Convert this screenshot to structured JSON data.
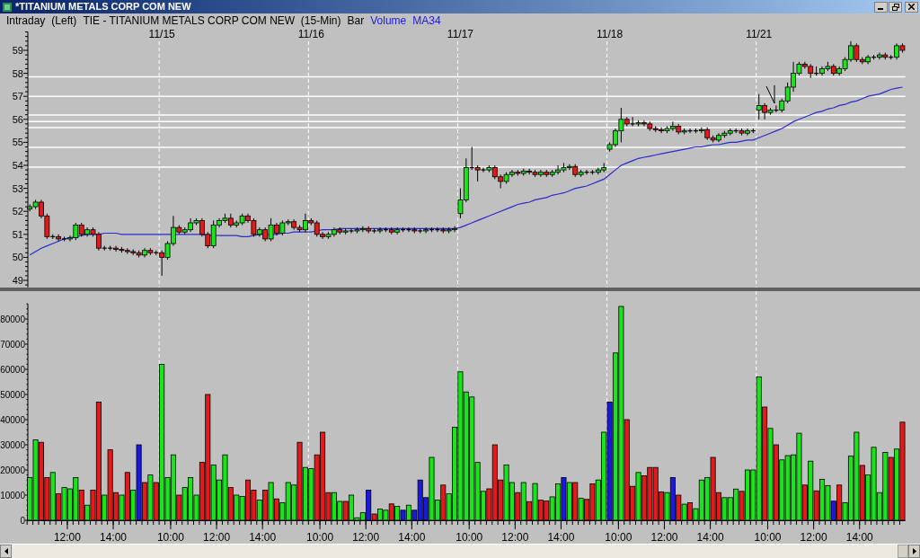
{
  "window": {
    "title": "*TITANIUM METALS CORP COM NEW"
  },
  "header": [
    {
      "text": "Intraday"
    },
    {
      "text": "(Left)"
    },
    {
      "text": "TIE - TITANIUM METALS CORP COM NEW  (15-Min)"
    },
    {
      "text": "Bar"
    }
  ],
  "price_panel": {
    "chart_data": {
      "type": "candlestick",
      "ylim": [
        48.7,
        59.8
      ],
      "yticks": [
        49,
        50,
        51,
        52,
        53,
        54,
        55,
        56,
        57,
        58,
        59
      ],
      "categories": [
        null,
        null,
        null,
        null,
        null,
        null,
        null,
        null,
        null,
        null,
        null,
        null,
        null,
        null,
        null,
        null,
        null,
        null,
        null,
        null,
        null,
        null,
        null,
        "11/15",
        null,
        null,
        null,
        null,
        null,
        null,
        null,
        null,
        null,
        null,
        null,
        null,
        null,
        null,
        null,
        null,
        null,
        null,
        null,
        null,
        null,
        null,
        null,
        null,
        null,
        "11/16",
        null,
        null,
        null,
        null,
        null,
        null,
        null,
        null,
        null,
        null,
        null,
        null,
        null,
        null,
        null,
        null,
        null,
        null,
        null,
        null,
        null,
        null,
        null,
        null,
        null,
        "11/17",
        null,
        null,
        null,
        null,
        null,
        null,
        null,
        null,
        null,
        null,
        null,
        null,
        null,
        null,
        null,
        null,
        null,
        null,
        null,
        null,
        null,
        null,
        null,
        null,
        null,
        "11/18",
        null,
        null,
        null,
        null,
        null,
        null,
        null,
        null,
        null,
        null,
        null,
        null,
        null,
        null,
        null,
        null,
        null,
        null,
        null,
        null,
        null,
        null,
        null,
        null,
        null,
        "11/21",
        null,
        null,
        null,
        null,
        null,
        null,
        null,
        null,
        null,
        null,
        null,
        null,
        null,
        null,
        null,
        null,
        null,
        null,
        null,
        null,
        null,
        null,
        null,
        null,
        null
      ],
      "ohlc": [
        [
          52.1,
          52.3,
          52.0,
          52.2
        ],
        [
          52.2,
          52.5,
          52.1,
          52.4
        ],
        [
          52.4,
          52.5,
          51.7,
          51.8
        ],
        [
          51.8,
          51.9,
          50.8,
          50.9
        ],
        [
          50.9,
          51.0,
          50.8,
          50.9
        ],
        [
          50.9,
          51.0,
          50.7,
          50.8
        ],
        [
          50.8,
          50.9,
          50.7,
          50.8
        ],
        [
          50.8,
          50.95,
          50.7,
          50.85
        ],
        [
          50.85,
          51.5,
          50.75,
          51.4
        ],
        [
          51.4,
          51.5,
          50.9,
          51.0
        ],
        [
          51.0,
          51.3,
          50.9,
          51.2
        ],
        [
          51.2,
          51.3,
          50.9,
          51.0
        ],
        [
          51.0,
          51.1,
          50.3,
          50.4
        ],
        [
          50.4,
          50.5,
          50.3,
          50.4
        ],
        [
          50.4,
          50.5,
          50.3,
          50.4
        ],
        [
          50.4,
          50.5,
          50.25,
          50.35
        ],
        [
          50.35,
          50.45,
          50.2,
          50.3
        ],
        [
          50.3,
          50.4,
          50.15,
          50.25
        ],
        [
          50.25,
          50.35,
          50.1,
          50.2
        ],
        [
          50.2,
          50.3,
          50.0,
          50.1
        ],
        [
          50.1,
          50.4,
          50.0,
          50.3
        ],
        [
          50.3,
          50.4,
          50.1,
          50.2
        ],
        [
          50.2,
          50.3,
          50.1,
          50.2
        ],
        [
          50.2,
          50.3,
          49.2,
          50.0
        ],
        [
          50.0,
          50.7,
          49.9,
          50.6
        ],
        [
          50.6,
          51.8,
          50.5,
          51.3
        ],
        [
          51.3,
          51.4,
          51.0,
          51.1
        ],
        [
          51.1,
          51.3,
          51.0,
          51.2
        ],
        [
          51.2,
          51.7,
          51.1,
          51.5
        ],
        [
          51.5,
          51.7,
          51.4,
          51.6
        ],
        [
          51.6,
          51.7,
          50.9,
          51.0
        ],
        [
          51.0,
          51.1,
          50.4,
          50.5
        ],
        [
          50.5,
          51.6,
          50.4,
          51.4
        ],
        [
          51.4,
          51.7,
          51.3,
          51.6
        ],
        [
          51.6,
          51.9,
          51.5,
          51.7
        ],
        [
          51.7,
          51.9,
          51.3,
          51.4
        ],
        [
          51.4,
          51.6,
          51.3,
          51.5
        ],
        [
          51.5,
          51.9,
          51.4,
          51.8
        ],
        [
          51.8,
          51.9,
          51.5,
          51.6
        ],
        [
          51.6,
          51.7,
          50.9,
          51.0
        ],
        [
          51.0,
          51.3,
          50.9,
          51.2
        ],
        [
          51.2,
          51.3,
          50.7,
          50.8
        ],
        [
          50.8,
          51.7,
          50.7,
          51.4
        ],
        [
          51.4,
          51.5,
          50.95,
          51.05
        ],
        [
          51.05,
          51.6,
          50.95,
          51.5
        ],
        [
          51.5,
          51.65,
          51.4,
          51.55
        ],
        [
          51.55,
          51.65,
          51.2,
          51.3
        ],
        [
          51.3,
          51.4,
          51.1,
          51.2
        ],
        [
          51.2,
          51.9,
          51.1,
          51.6
        ],
        [
          51.6,
          51.7,
          51.4,
          51.5
        ],
        [
          51.5,
          51.6,
          50.9,
          51.0
        ],
        [
          51.0,
          51.1,
          50.8,
          50.9
        ],
        [
          50.9,
          51.1,
          50.8,
          51.0
        ],
        [
          51.0,
          51.3,
          50.9,
          51.2
        ],
        [
          51.2,
          51.3,
          51.0,
          51.1
        ],
        [
          51.1,
          51.25,
          51.0,
          51.15
        ],
        [
          51.15,
          51.25,
          51.05,
          51.15
        ],
        [
          51.15,
          51.3,
          51.05,
          51.2
        ],
        [
          51.2,
          51.35,
          51.1,
          51.25
        ],
        [
          51.25,
          51.35,
          51.05,
          51.15
        ],
        [
          51.15,
          51.25,
          51.05,
          51.15
        ],
        [
          51.15,
          51.3,
          51.05,
          51.2
        ],
        [
          51.2,
          51.3,
          51.1,
          51.2
        ],
        [
          51.2,
          51.3,
          51.0,
          51.1
        ],
        [
          51.1,
          51.3,
          51.0,
          51.2
        ],
        [
          51.2,
          51.3,
          51.1,
          51.2
        ],
        [
          51.2,
          51.3,
          51.1,
          51.2
        ],
        [
          51.2,
          51.3,
          51.05,
          51.15
        ],
        [
          51.15,
          51.25,
          51.05,
          51.15
        ],
        [
          51.15,
          51.3,
          51.05,
          51.2
        ],
        [
          51.2,
          51.3,
          51.1,
          51.2
        ],
        [
          51.2,
          51.3,
          51.1,
          51.2
        ],
        [
          51.2,
          51.3,
          51.05,
          51.15
        ],
        [
          51.15,
          51.3,
          51.05,
          51.2
        ],
        [
          51.2,
          51.35,
          51.1,
          51.25
        ],
        [
          51.9,
          53.0,
          51.7,
          52.5
        ],
        [
          52.5,
          54.3,
          52.4,
          53.9
        ],
        [
          53.9,
          54.8,
          53.8,
          53.9
        ],
        [
          53.9,
          54.0,
          53.3,
          53.8
        ],
        [
          53.8,
          53.9,
          53.7,
          53.8
        ],
        [
          53.8,
          54.0,
          53.7,
          53.9
        ],
        [
          53.9,
          54.0,
          53.4,
          53.5
        ],
        [
          53.5,
          53.6,
          53.0,
          53.3
        ],
        [
          53.3,
          53.7,
          53.2,
          53.6
        ],
        [
          53.6,
          53.8,
          53.5,
          53.7
        ],
        [
          53.7,
          53.8,
          53.55,
          53.65
        ],
        [
          53.65,
          53.85,
          53.55,
          53.75
        ],
        [
          53.75,
          53.85,
          53.6,
          53.7
        ],
        [
          53.7,
          53.8,
          53.5,
          53.6
        ],
        [
          53.6,
          53.8,
          53.5,
          53.7
        ],
        [
          53.7,
          53.8,
          53.5,
          53.6
        ],
        [
          53.6,
          53.8,
          53.5,
          53.7
        ],
        [
          53.7,
          54.0,
          53.6,
          53.8
        ],
        [
          53.8,
          54.1,
          53.7,
          53.9
        ],
        [
          53.9,
          54.05,
          53.8,
          53.95
        ],
        [
          53.95,
          54.05,
          53.5,
          53.6
        ],
        [
          53.6,
          53.8,
          53.5,
          53.7
        ],
        [
          53.7,
          53.8,
          53.6,
          53.7
        ],
        [
          53.7,
          53.8,
          53.6,
          53.7
        ],
        [
          53.7,
          53.9,
          53.6,
          53.8
        ],
        [
          53.8,
          54.1,
          53.7,
          53.9
        ],
        [
          54.7,
          55.0,
          54.6,
          54.9
        ],
        [
          54.9,
          55.6,
          54.8,
          55.5
        ],
        [
          55.5,
          56.5,
          55.0,
          56.0
        ],
        [
          56.0,
          56.1,
          55.7,
          55.8
        ],
        [
          55.8,
          56.1,
          55.7,
          55.8
        ],
        [
          55.8,
          55.95,
          55.7,
          55.85
        ],
        [
          55.85,
          55.95,
          55.7,
          55.8
        ],
        [
          55.8,
          55.9,
          55.5,
          55.6
        ],
        [
          55.6,
          55.7,
          55.45,
          55.55
        ],
        [
          55.55,
          55.65,
          55.4,
          55.5
        ],
        [
          55.5,
          55.7,
          55.4,
          55.6
        ],
        [
          55.6,
          55.9,
          55.5,
          55.7
        ],
        [
          55.7,
          55.8,
          55.35,
          55.45
        ],
        [
          55.45,
          55.6,
          55.35,
          55.5
        ],
        [
          55.5,
          55.6,
          55.4,
          55.5
        ],
        [
          55.5,
          55.6,
          55.4,
          55.5
        ],
        [
          55.5,
          55.65,
          55.4,
          55.55
        ],
        [
          55.55,
          55.65,
          55.1,
          55.2
        ],
        [
          55.2,
          55.3,
          55.0,
          55.1
        ],
        [
          55.1,
          55.4,
          55.0,
          55.3
        ],
        [
          55.3,
          55.5,
          55.2,
          55.4
        ],
        [
          55.4,
          55.6,
          55.3,
          55.5
        ],
        [
          55.5,
          55.6,
          55.4,
          55.5
        ],
        [
          55.5,
          55.6,
          55.3,
          55.4
        ],
        [
          55.4,
          55.6,
          55.3,
          55.5
        ],
        [
          55.5,
          55.6,
          55.4,
          55.5
        ],
        [
          56.4,
          57.1,
          56.0,
          56.6
        ],
        [
          56.6,
          56.7,
          56.0,
          56.3
        ],
        [
          56.3,
          56.5,
          56.2,
          56.4
        ],
        [
          56.4,
          56.6,
          56.3,
          56.4
        ],
        [
          56.4,
          56.9,
          56.3,
          56.8
        ],
        [
          56.8,
          57.6,
          56.7,
          57.4
        ],
        [
          57.4,
          58.5,
          57.2,
          58.0
        ],
        [
          58.0,
          58.5,
          57.9,
          58.4
        ],
        [
          58.4,
          58.5,
          58.2,
          58.3
        ],
        [
          58.3,
          58.4,
          57.8,
          58.0
        ],
        [
          58.0,
          58.3,
          57.9,
          58.0
        ],
        [
          58.0,
          58.3,
          57.9,
          58.2
        ],
        [
          58.2,
          58.5,
          58.1,
          58.3
        ],
        [
          58.3,
          58.4,
          57.9,
          58.0
        ],
        [
          58.0,
          58.3,
          57.9,
          58.2
        ],
        [
          58.2,
          58.7,
          58.1,
          58.6
        ],
        [
          58.6,
          59.4,
          58.5,
          59.2
        ],
        [
          59.2,
          59.3,
          58.5,
          58.6
        ],
        [
          58.6,
          58.7,
          58.4,
          58.5
        ],
        [
          58.5,
          58.8,
          58.4,
          58.7
        ],
        [
          58.7,
          58.8,
          58.6,
          58.7
        ],
        [
          58.7,
          58.9,
          58.6,
          58.8
        ],
        [
          58.8,
          58.9,
          58.6,
          58.7
        ],
        [
          58.7,
          58.8,
          58.6,
          58.7
        ],
        [
          58.7,
          59.3,
          58.6,
          59.2
        ],
        [
          59.2,
          59.3,
          58.9,
          59.0
        ]
      ],
      "series": [
        {
          "name": "MA34",
          "type": "line",
          "color": "#2a2ad0",
          "values": [
            50.1,
            50.25,
            50.4,
            50.5,
            50.6,
            50.7,
            50.8,
            50.85,
            50.9,
            50.95,
            51.0,
            51.0,
            51.0,
            51.05,
            51.05,
            51.05,
            51.0,
            51.0,
            51.0,
            51.0,
            51.0,
            51.0,
            51.0,
            51.0,
            51.0,
            51.0,
            51.0,
            51.0,
            51.0,
            51.0,
            51.0,
            50.95,
            50.95,
            50.95,
            50.95,
            50.95,
            50.95,
            50.9,
            50.9,
            50.95,
            51.0,
            51.0,
            51.0,
            51.0,
            51.05,
            51.05,
            51.1,
            51.1,
            51.1,
            51.1,
            51.15,
            51.2,
            51.2,
            51.2,
            51.25,
            51.25,
            51.25,
            51.25,
            51.25,
            51.25,
            51.25,
            51.25,
            51.25,
            51.25,
            51.25,
            51.25,
            51.25,
            51.25,
            51.25,
            51.25,
            51.25,
            51.25,
            51.25,
            51.25,
            51.25,
            51.3,
            51.4,
            51.5,
            51.6,
            51.7,
            51.8,
            51.9,
            52.0,
            52.1,
            52.2,
            52.3,
            52.35,
            52.4,
            52.5,
            52.55,
            52.6,
            52.7,
            52.75,
            52.8,
            52.9,
            53.0,
            53.05,
            53.1,
            53.2,
            53.3,
            53.4,
            53.6,
            53.8,
            54.0,
            54.1,
            54.2,
            54.3,
            54.35,
            54.4,
            54.45,
            54.5,
            54.55,
            54.6,
            54.65,
            54.7,
            54.75,
            54.8,
            54.8,
            54.85,
            54.9,
            54.9,
            54.95,
            55.0,
            55.0,
            55.05,
            55.1,
            55.1,
            55.2,
            55.3,
            55.4,
            55.5,
            55.6,
            55.75,
            55.9,
            56.0,
            56.1,
            56.2,
            56.3,
            56.35,
            56.45,
            56.5,
            56.6,
            56.65,
            56.75,
            56.8,
            56.9,
            57.0,
            57.05,
            57.1,
            57.2,
            57.3,
            57.35,
            57.4
          ]
        }
      ],
      "ref_lines": [
        {
          "axis": "y",
          "value": 57.85
        },
        {
          "axis": "y",
          "value": 57.0
        },
        {
          "axis": "y",
          "value": 56.19
        },
        {
          "axis": "y",
          "value": 55.9
        },
        {
          "axis": "y",
          "value": 55.64
        },
        {
          "axis": "y",
          "value": 54.78
        },
        {
          "axis": "y",
          "value": 53.92
        }
      ]
    }
  },
  "volume_panel": {
    "chart_data": {
      "type": "bar",
      "ylim": [
        0,
        86000
      ],
      "yticks": [
        0,
        10000,
        20000,
        30000,
        40000,
        50000,
        60000,
        70000,
        80000
      ],
      "categories": [
        null,
        null,
        null,
        null,
        null,
        null,
        null,
        "12:00",
        null,
        null,
        null,
        null,
        null,
        null,
        null,
        "14:00",
        null,
        null,
        null,
        null,
        null,
        null,
        null,
        null,
        null,
        "10:00",
        null,
        null,
        null,
        null,
        null,
        null,
        null,
        "12:00",
        null,
        null,
        null,
        null,
        null,
        null,
        null,
        "14:00",
        null,
        null,
        null,
        null,
        null,
        null,
        null,
        null,
        null,
        "10:00",
        null,
        null,
        null,
        null,
        null,
        null,
        null,
        "12:00",
        null,
        null,
        null,
        null,
        null,
        null,
        null,
        "14:00",
        null,
        null,
        null,
        null,
        null,
        null,
        null,
        null,
        null,
        "10:00",
        null,
        null,
        null,
        null,
        null,
        null,
        null,
        "12:00",
        null,
        null,
        null,
        null,
        null,
        null,
        null,
        "14:00",
        null,
        null,
        null,
        null,
        null,
        null,
        null,
        null,
        null,
        "10:00",
        null,
        null,
        null,
        null,
        null,
        null,
        null,
        "12:00",
        null,
        null,
        null,
        null,
        null,
        null,
        null,
        "14:00",
        null,
        null,
        null,
        null,
        null,
        null,
        null,
        null,
        null,
        "10:00",
        null,
        null,
        null,
        null,
        null,
        null,
        null,
        "12:00",
        null,
        null,
        null,
        null,
        null,
        null,
        null,
        "14:00",
        null,
        null,
        null,
        null,
        null,
        null,
        null
      ],
      "series": [
        {
          "name": "Volume",
          "values": [
            17000,
            32000,
            31000,
            17000,
            19000,
            10500,
            13000,
            12500,
            17000,
            12000,
            6000,
            12000,
            47000,
            10000,
            28000,
            11000,
            10000,
            19000,
            12000,
            30000,
            15000,
            18000,
            15000,
            62000,
            17000,
            26000,
            10000,
            13000,
            17000,
            10000,
            23000,
            50000,
            22000,
            16000,
            26000,
            13000,
            10000,
            9500,
            16000,
            12000,
            8000,
            12000,
            15000,
            8500,
            7000,
            15000,
            14000,
            31000,
            21000,
            20500,
            26000,
            35000,
            11000,
            11000,
            7500,
            7500,
            10000,
            1000,
            3000,
            12000,
            2500,
            4500,
            4000,
            6500,
            5500,
            4000,
            6000,
            4000,
            16000,
            9000,
            25000,
            8000,
            14000,
            10500,
            37000,
            59000,
            51000,
            49000,
            23000,
            11500,
            12500,
            30000,
            16000,
            22000,
            15000,
            11000,
            15000,
            7400,
            14600,
            8000,
            7700,
            9300,
            14500,
            17000,
            15000,
            15000,
            8700,
            8300,
            14500,
            16000,
            35000,
            47000,
            66500,
            85000,
            40000,
            13500,
            19000,
            17700,
            21000,
            21000,
            11300,
            11000,
            17000,
            10000,
            6400,
            7000,
            4600,
            16000,
            17000,
            25000,
            11000,
            9000,
            9000,
            12400,
            11500,
            20000,
            20000,
            57000,
            45000,
            36500,
            30000,
            24000,
            25700,
            26000,
            34600,
            14000,
            23500,
            11700,
            16300,
            13800,
            7600,
            14000,
            7000,
            25500,
            35000,
            21800,
            18000,
            29000,
            11000,
            27000,
            25000,
            28300,
            39000
          ],
          "colors": [
            "#19e619",
            "#19e619",
            "#e61919",
            "#e61919",
            "#19e619",
            "#e61919",
            "#19e619",
            "#19e619",
            "#19e619",
            "#e61919",
            "#19e619",
            "#e61919",
            "#e61919",
            "#19e619",
            "#e61919",
            "#e61919",
            "#19e619",
            "#e61919",
            "#19e619",
            "#1919e0",
            "#e61919",
            "#19e619",
            "#e61919",
            "#19e619",
            "#19e619",
            "#19e619",
            "#e61919",
            "#19e619",
            "#19e619",
            "#19e619",
            "#e61919",
            "#e61919",
            "#19e619",
            "#19e619",
            "#19e619",
            "#e61919",
            "#19e619",
            "#19e619",
            "#e61919",
            "#e61919",
            "#19e619",
            "#e61919",
            "#19e619",
            "#e61919",
            "#19e619",
            "#19e619",
            "#19e619",
            "#e61919",
            "#19e619",
            "#19e619",
            "#e61919",
            "#e61919",
            "#e61919",
            "#19e619",
            "#19e619",
            "#e61919",
            "#19e619",
            "#19e619",
            "#19e619",
            "#1919e0",
            "#e61919",
            "#19e619",
            "#19e619",
            "#e61919",
            "#19e619",
            "#1919e0",
            "#19e619",
            "#1919e0",
            "#1919e0",
            "#1919e0",
            "#19e619",
            "#19e619",
            "#e61919",
            "#19e619",
            "#19e619",
            "#19e619",
            "#19e619",
            "#19e619",
            "#19e619",
            "#19e619",
            "#e61919",
            "#e61919",
            "#e61919",
            "#19e619",
            "#19e619",
            "#e61919",
            "#19e619",
            "#e61919",
            "#19e619",
            "#e61919",
            "#e61919",
            "#19e619",
            "#19e619",
            "#1919e0",
            "#19e619",
            "#e61919",
            "#19e619",
            "#e61919",
            "#e61919",
            "#19e619",
            "#19e619",
            "#1919e0",
            "#19e619",
            "#19e619",
            "#e61919",
            "#e61919",
            "#19e619",
            "#e61919",
            "#e61919",
            "#e61919",
            "#e61919",
            "#19e619",
            "#1919e0",
            "#e61919",
            "#19e619",
            "#e61919",
            "#19e619",
            "#19e619",
            "#19e619",
            "#e61919",
            "#e61919",
            "#19e619",
            "#19e619",
            "#19e619",
            "#e61919",
            "#19e619",
            "#19e619",
            "#19e619",
            "#e61919",
            "#19e619",
            "#e61919",
            "#19e619",
            "#19e619",
            "#19e619",
            "#19e619",
            "#e61919",
            "#19e619",
            "#e61919",
            "#19e619",
            "#19e619",
            "#1919e0",
            "#e61919",
            "#19e619",
            "#19e619",
            "#19e619",
            "#e61919",
            "#19e619",
            "#19e619",
            "#19e619",
            "#19e619",
            "#e61919",
            "#19e619",
            "#e61919"
          ]
        }
      ]
    }
  }
}
